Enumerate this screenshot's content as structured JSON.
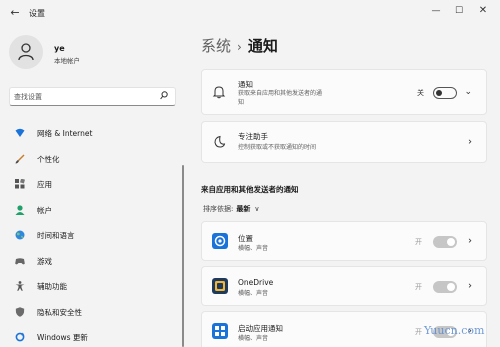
{
  "window": {
    "title": "设置",
    "back_glyph": "←",
    "minimize_glyph": "—",
    "maximize_glyph": "☐",
    "close_glyph": "✕"
  },
  "profile": {
    "name": "ye",
    "account_type": "本地帐户"
  },
  "search": {
    "placeholder": "查找设置"
  },
  "sidebar": {
    "items": [
      {
        "label": "网络 & Internet",
        "icon": "wifi-icon"
      },
      {
        "label": "个性化",
        "icon": "brush-icon"
      },
      {
        "label": "应用",
        "icon": "apps-icon"
      },
      {
        "label": "帐户",
        "icon": "person-icon"
      },
      {
        "label": "时间和语言",
        "icon": "globe-icon"
      },
      {
        "label": "游戏",
        "icon": "gamepad-icon"
      },
      {
        "label": "辅助功能",
        "icon": "accessibility-icon"
      },
      {
        "label": "隐私和安全性",
        "icon": "shield-icon"
      },
      {
        "label": "Windows 更新",
        "icon": "update-icon"
      }
    ]
  },
  "breadcrumb": {
    "parent": "系统",
    "separator": "›",
    "current": "通知"
  },
  "notifications": {
    "title": "通知",
    "subtitle_line1": "获取来自应用和其他发送者的通",
    "subtitle_line2": "知",
    "state": "关",
    "enabled": false
  },
  "focus_assist": {
    "title": "专注助手",
    "subtitle": "控制获取或不获取通知的时间"
  },
  "section": {
    "title": "来自应用和其他发送者的通知",
    "sort_label": "排序依据:",
    "sort_value": "最新"
  },
  "apps": [
    {
      "name": "位置",
      "detail": "横幅、声音",
      "state": "开",
      "icon": "location-icon",
      "color": "#1a73d9"
    },
    {
      "name": "OneDrive",
      "detail": "横幅、声音",
      "state": "开",
      "icon": "onedrive-icon",
      "color": "#1f3a5f"
    },
    {
      "name": "启动应用通知",
      "detail": "横幅、声音",
      "state": "开",
      "icon": "startup-apps-icon",
      "color": "#1a73d9"
    }
  ],
  "watermark": "Yuucn.com",
  "colors": {
    "accent": "#1a73d9",
    "background": "#f3f3f3",
    "card": "#fbfbfb"
  }
}
